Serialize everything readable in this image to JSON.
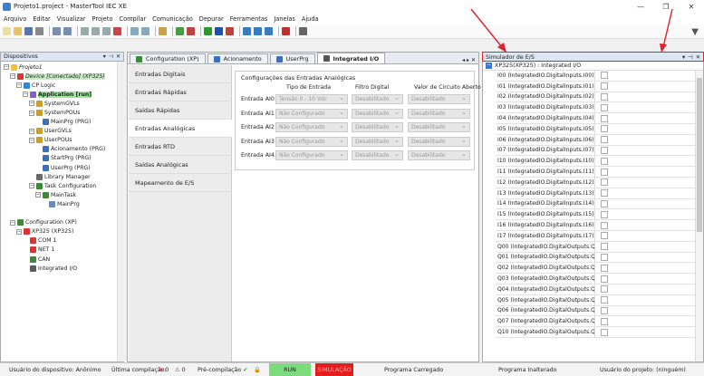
{
  "window": {
    "title": "Projeto1.project - MasterTool IEC XE"
  },
  "menu": [
    "Arquivo",
    "Editar",
    "Visualizar",
    "Projeto",
    "Compilar",
    "Comunicação",
    "Depurar",
    "Ferramentas",
    "Janelas",
    "Ajuda"
  ],
  "devices_panel": {
    "title": "Dispositivos",
    "tree": [
      {
        "label": "Projeto1",
        "indent": 0,
        "style": "italic"
      },
      {
        "label": "Device [Conectado] (XP325)",
        "indent": 1,
        "style": "device"
      },
      {
        "label": "CP Logic",
        "indent": 2
      },
      {
        "label": "Application [run]",
        "indent": 3,
        "style": "app"
      },
      {
        "label": "SystemGVLs",
        "indent": 4
      },
      {
        "label": "SystemPOUs",
        "indent": 4
      },
      {
        "label": "MainPrg (PRG)",
        "indent": 5
      },
      {
        "label": "UserGVLs",
        "indent": 4
      },
      {
        "label": "UserPOUs",
        "indent": 4
      },
      {
        "label": "Acionamento (PRG)",
        "indent": 5
      },
      {
        "label": "StartPrg (PRG)",
        "indent": 5
      },
      {
        "label": "UserPrg (PRG)",
        "indent": 5
      },
      {
        "label": "Library Manager",
        "indent": 4
      },
      {
        "label": "Task Configuration",
        "indent": 4
      },
      {
        "label": "MainTask",
        "indent": 5
      },
      {
        "label": "MainPrg",
        "indent": 6
      },
      {
        "label": "",
        "indent": 0
      },
      {
        "label": "Configuration (XP)",
        "indent": 1
      },
      {
        "label": "XP325 (XP325)",
        "indent": 2
      },
      {
        "label": "COM 1",
        "indent": 3
      },
      {
        "label": "NET 1",
        "indent": 3
      },
      {
        "label": "CAN",
        "indent": 3
      },
      {
        "label": "Integrated I/O",
        "indent": 3
      }
    ]
  },
  "editor": {
    "tabs": [
      "Configuration (XP)",
      "Acionamento",
      "UserPrg",
      "Integrated I/O"
    ],
    "active_tab": "Integrated I/O",
    "nav": [
      "Entradas Digitais",
      "Entradas Rápidas",
      "Saídas Rápidas",
      "Entradas Analógicas",
      "Entradas RTD",
      "Saídas Analógicas",
      "Mapeamento de E/S"
    ],
    "active_nav": "Entradas Analógicas",
    "section_title": "Configurações das Entradas Analógicas",
    "columns": [
      "Tipo de Entrada",
      "Filtro Digital",
      "Valor de Circuito Aberto"
    ],
    "rows": [
      {
        "name": "Entrada AI0",
        "type": "Tensão 0 - 10 Vdc",
        "filter": "Desabilitado",
        "open": "Desabilitado"
      },
      {
        "name": "Entrada AI1",
        "type": "Não Configurado",
        "filter": "Desabilitado",
        "open": "Desabilitado"
      },
      {
        "name": "Entrada AI2",
        "type": "Não Configurado",
        "filter": "Desabilitado",
        "open": "Desabilitado"
      },
      {
        "name": "Entrada AI3",
        "type": "Não Configurado",
        "filter": "Desabilitado",
        "open": "Desabilitado"
      },
      {
        "name": "Entrada AI4",
        "type": "Não Configurado",
        "filter": "Desabilitado",
        "open": "Desabilitado"
      }
    ]
  },
  "simulator": {
    "title": "Simulador de E/S",
    "root": "XP325(XP325) : Integrated I/O",
    "items": [
      "I00 (IntegratedIO.DigitalInputs.I00)",
      "I01 (IntegratedIO.DigitalInputs.I01)",
      "I02 (IntegratedIO.DigitalInputs.I02)",
      "I03 (IntegratedIO.DigitalInputs.I03)",
      "I04 (IntegratedIO.DigitalInputs.I04)",
      "I05 (IntegratedIO.DigitalInputs.I05)",
      "I06 (IntegratedIO.DigitalInputs.I06)",
      "I07 (IntegratedIO.DigitalInputs.I07)",
      "I10 (IntegratedIO.DigitalInputs.I10)",
      "I11 (IntegratedIO.DigitalInputs.I11)",
      "I12 (IntegratedIO.DigitalInputs.I12)",
      "I13 (IntegratedIO.DigitalInputs.I13)",
      "I14 (IntegratedIO.DigitalInputs.I14)",
      "I15 (IntegratedIO.DigitalInputs.I15)",
      "I16 (IntegratedIO.DigitalInputs.I16)",
      "I17 (IntegratedIO.DigitalInputs.I17)",
      "Q00 (IntegratedIO.DigitalOutputs.Q0…",
      "Q01 (IntegratedIO.DigitalOutputs.Q0…",
      "Q02 (IntegratedIO.DigitalOutputs.Q0…",
      "Q03 (IntegratedIO.DigitalOutputs.Q0…",
      "Q04 (IntegratedIO.DigitalOutputs.Q0…",
      "Q05 (IntegratedIO.DigitalOutputs.Q0…",
      "Q06 (IntegratedIO.DigitalOutputs.Q0…",
      "Q07 (IntegratedIO.DigitalOutputs.Q0…",
      "Q10 (IntegratedIO.DigitalOutputs.Q1…"
    ]
  },
  "status": {
    "user_device": "Usuário do dispositivo: Anônimo",
    "last_compile": "Última compilação:",
    "err_count": "0",
    "warn_count": "0",
    "precompile": "Pré-compilação",
    "run": "RUN",
    "simulation": "SIMULAÇÃO",
    "program_loaded": "Programa Carregado",
    "program_unchanged": "Programa Inalterado",
    "user_project": "Usuário do projeto: (ninguém)"
  },
  "colors": {
    "annotation_red": "#e0202a",
    "run_green": "#7cdb7c",
    "sim_red": "#e31c1c",
    "app_highlight": "#9be89b"
  }
}
